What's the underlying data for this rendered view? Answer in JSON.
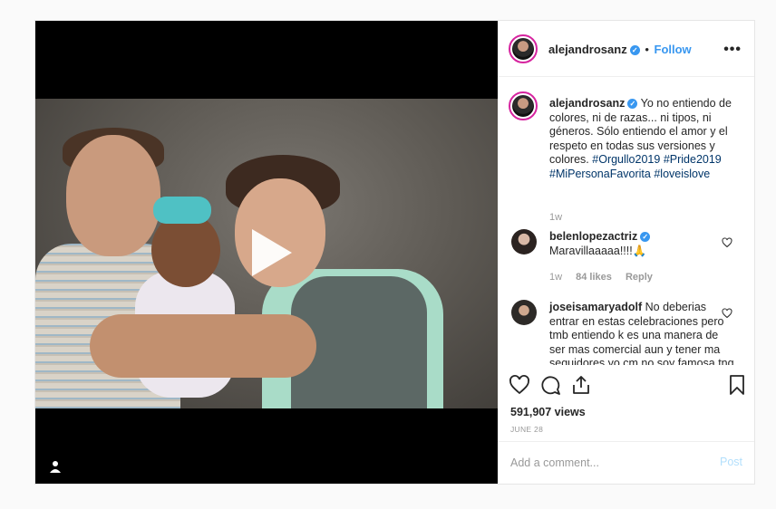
{
  "header": {
    "username": "alejandrosanz",
    "separator": "•",
    "follow_label": "Follow",
    "more_label": "•••"
  },
  "caption": {
    "username": "alejandrosanz",
    "text": "Yo no entiendo de colores, ni de razas... ni tipos, ni géneros. Sólo entiendo el amor y el respeto en todas sus versiones y colores.",
    "hashtags": [
      "#Orgullo2019",
      "#Pride2019",
      "#MiPersonaFavorita",
      "#loveislove"
    ],
    "time": "1w"
  },
  "comments": [
    {
      "username": "belenlopezactriz",
      "verified": true,
      "text": "Maravillaaaaa!!!!🙏",
      "time": "1w",
      "likes": "84 likes",
      "reply_label": "Reply"
    },
    {
      "username": "joseisamaryadolf",
      "verified": false,
      "text": "No deberias entrar en estas celebraciones pero tmb entiendo k es una manera de ser mas comercial aun y tener ma seguidores yo cm no soy famosa tng la libertad de"
    }
  ],
  "stats": {
    "views": "591,907 views",
    "date": "JUNE 28"
  },
  "add_comment": {
    "placeholder": "Add a comment...",
    "post_label": "Post"
  },
  "icons": {
    "play": "play-icon",
    "profile": "user-icon",
    "like": "heart-icon",
    "comment": "comment-icon",
    "share": "share-icon",
    "save": "bookmark-icon"
  },
  "colors": {
    "accent": "#3897f0",
    "hashtag": "#003569",
    "muted": "#999999",
    "post_disabled": "#b2dffc"
  }
}
